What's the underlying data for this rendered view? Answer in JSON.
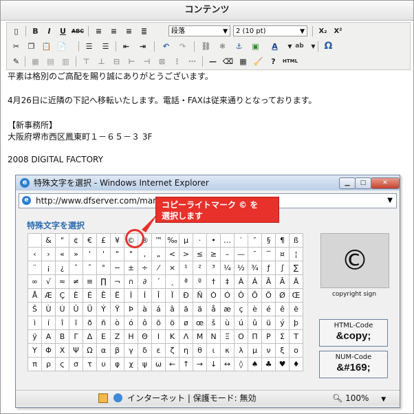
{
  "panel": {
    "title": "コンテンツ"
  },
  "toolbar": {
    "row1": {
      "bold": "B",
      "italic": "I",
      "underline": "U",
      "strike": "ABC",
      "format_select": "段落",
      "size_select": "2 (10 pt)",
      "subscript": "X₂",
      "superscript": "X²"
    },
    "row3": {
      "html_label": "HTML"
    },
    "charmap_glyph": "Ω"
  },
  "editor": {
    "lines": [
      "平素は格別のご高配を賜り誠にありがとうございます。",
      "4月26日に近隣の下記へ移転いたします。電話・FAXは従来通りとなっております。",
      "【新事務所】",
      "大阪府堺市西区鳳東町１－６５－３ 3F",
      "2008 DIGITAL FACTORY"
    ]
  },
  "ie_window": {
    "title": "特殊文字を選択 - Windows Internet Explorer",
    "url": "http://www.dfserver.com/man                          s/tiny_mce/themes/advai"
  },
  "dialog": {
    "heading": "特殊文字を選択",
    "rows": [
      [
        " ",
        "&",
        "\"",
        "¢",
        "€",
        "£",
        "¥",
        "©",
        "®",
        "™",
        "‰",
        "µ",
        "·",
        "•",
        "…",
        "′",
        "″",
        "§",
        "¶",
        "ß"
      ],
      [
        "‹",
        "›",
        "«",
        "»",
        "'",
        "'",
        "\"",
        "\"",
        "‚",
        "„",
        "<",
        ">",
        "≤",
        "≥",
        "–",
        "—",
        "¯",
        "‾",
        "¤",
        "¦"
      ],
      [
        "¨",
        "¡",
        "¿",
        "ˆ",
        "˜",
        "°",
        "−",
        "±",
        "÷",
        "⁄",
        "×",
        "¹",
        "²",
        "³",
        "¼",
        "½",
        "¾",
        "ƒ",
        "∫",
        "∑"
      ],
      [
        "∞",
        "√",
        "≈",
        "≠",
        "≡",
        "∏",
        "¬",
        "∩",
        "∂",
        "´",
        "¸",
        "ª",
        "º",
        "†",
        "‡",
        "À",
        "Á",
        "Â",
        "Ã",
        "Ä"
      ],
      [
        "Å",
        "Æ",
        "Ç",
        "È",
        "É",
        "Ê",
        "Ë",
        "Ì",
        "Í",
        "Î",
        "Ï",
        "Ð",
        "Ñ",
        "Ò",
        "Ó",
        "Ô",
        "Õ",
        "Ö",
        "Ø",
        "Œ"
      ],
      [
        "Š",
        "Ù",
        "Ú",
        "Û",
        "Ü",
        "Ý",
        "Ÿ",
        "Þ",
        "à",
        "á",
        "â",
        "ã",
        "ä",
        "å",
        "æ",
        "ç",
        "è",
        "é",
        "ê",
        "ë"
      ],
      [
        "ì",
        "í",
        "î",
        "ï",
        "ð",
        "ñ",
        "ò",
        "ó",
        "ô",
        "õ",
        "ö",
        "ø",
        "œ",
        "š",
        "ù",
        "ú",
        "û",
        "ü",
        "ý",
        "þ"
      ],
      [
        "ÿ",
        "Α",
        "Β",
        "Γ",
        "Δ",
        "Ε",
        "Ζ",
        "Η",
        "Θ",
        "Ι",
        "Κ",
        "Λ",
        "Μ",
        "Ν",
        "Ξ",
        "Ο",
        "Π",
        "Ρ",
        "Σ",
        "Τ"
      ],
      [
        "Υ",
        "Φ",
        "Χ",
        "Ψ",
        "Ω",
        "α",
        "β",
        "γ",
        "δ",
        "ε",
        "ζ",
        "η",
        "θ",
        "ι",
        "κ",
        "λ",
        "μ",
        "ν",
        "ξ",
        "ο"
      ],
      [
        "π",
        "ρ",
        "ς",
        "σ",
        "τ",
        "υ",
        "φ",
        "χ",
        "ψ",
        "ω",
        "←",
        "↑",
        "→",
        "↓",
        "↔",
        "◊",
        "♠",
        "♣",
        "♥",
        "♦"
      ]
    ],
    "preview_char": "©",
    "preview_name": "copyright sign",
    "html_code_label": "HTML-Code",
    "html_code_value": "&copy;",
    "num_code_label": "NUM-Code",
    "num_code_value": "&#169;"
  },
  "status_bar": {
    "zone": "インターネット | 保護モード: 無効",
    "zoom": "100%"
  },
  "annotation": {
    "callout_line1": "コピーライトマーク © を",
    "callout_line2": "選択します",
    "accent_color": "#e8312a"
  }
}
